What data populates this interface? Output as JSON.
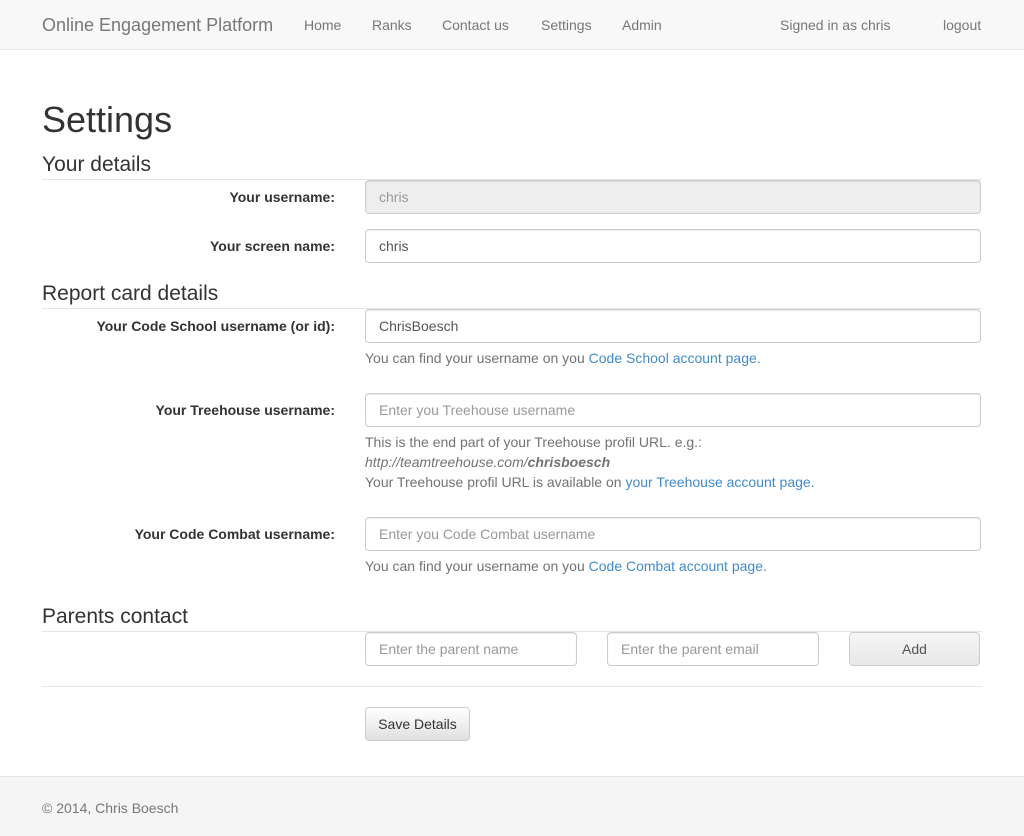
{
  "navbar": {
    "brand": "Online Engagement Platform",
    "links": [
      "Home",
      "Ranks",
      "Contact us",
      "Settings",
      "Admin"
    ],
    "signed_in": "Signed in as chris",
    "logout": "logout"
  },
  "page": {
    "title": "Settings"
  },
  "your_details": {
    "heading": "Your details",
    "username_label": "Your username:",
    "username_value": "chris",
    "screen_name_label": "Your screen name:",
    "screen_name_value": "chris"
  },
  "report_card": {
    "heading": "Report card details",
    "codeschool_label": "Your Code School username (or id):",
    "codeschool_value": "ChrisBoesch",
    "codeschool_help_prefix": "You can find your username on you ",
    "codeschool_help_link": "Code School account page.",
    "treehouse_label": "Your Treehouse username:",
    "treehouse_placeholder": "Enter you Treehouse username",
    "treehouse_help_line1": "This is the end part of your Treehouse profil URL. e.g.:",
    "treehouse_help_url_base": "http://teamtreehouse.com/",
    "treehouse_help_url_user": "chrisboesch",
    "treehouse_help_line3_prefix": "Your Treehouse profil URL is available on ",
    "treehouse_help_link": "your Treehouse account page.",
    "codecombat_label": "Your Code Combat username:",
    "codecombat_placeholder": "Enter you Code Combat username",
    "codecombat_help_prefix": "You can find your username on you ",
    "codecombat_help_link": "Code Combat account page."
  },
  "parents": {
    "heading": "Parents contact",
    "name_placeholder": "Enter the parent name",
    "email_placeholder": "Enter the parent email",
    "add_label": "Add"
  },
  "actions": {
    "save_label": "Save Details"
  },
  "footer": {
    "text": "© 2014, Chris Boesch"
  },
  "colors": {
    "link": "#428bca",
    "navbar_bg": "#f8f8f8",
    "muted": "#777777"
  }
}
